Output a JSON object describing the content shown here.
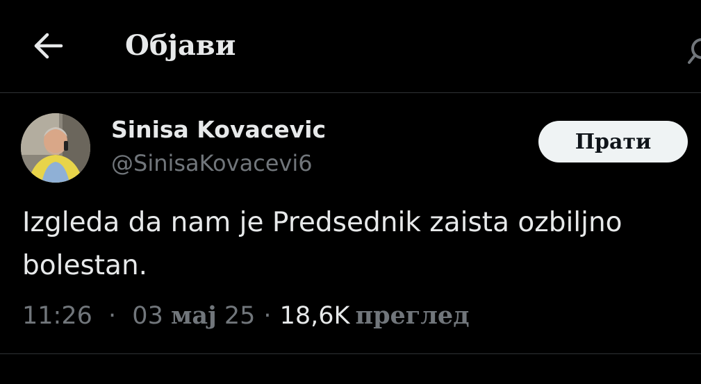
{
  "header": {
    "back_icon": "arrow-left-icon",
    "title": "Објави",
    "search_icon": "search-icon"
  },
  "tweet": {
    "avatar_icon": "user-avatar",
    "display_name": "Sinisa Kovacevic",
    "handle": "@SinisaKovacevi6",
    "follow_label": "Прати",
    "text": "Izgleda da nam je Predsednik zaista ozbiljno\nbolestan.",
    "time": "11:26",
    "date_day": "03",
    "date_month": "мај",
    "date_year": "25",
    "separator": "·",
    "views_count": "18,6K",
    "views_label": "преглед"
  },
  "colors": {
    "background": "#000000",
    "primary_text": "#e7e9ea",
    "secondary_text": "#71767b",
    "divider": "#2f3336",
    "follow_bg": "#eff3f4"
  }
}
